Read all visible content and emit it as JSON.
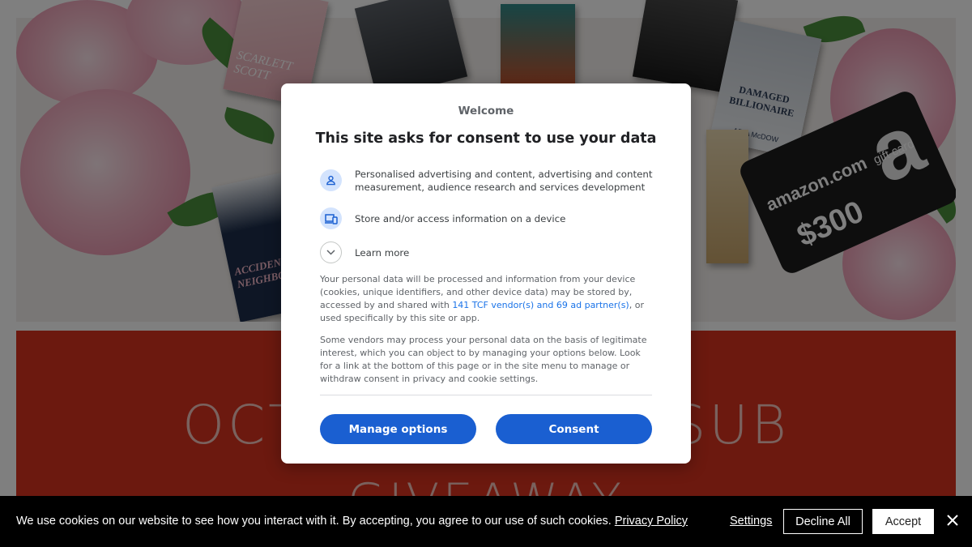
{
  "background": {
    "banner_line1": "OCTOBER BOOK SUB",
    "banner_line2": "GIVEAWAY",
    "gift_card": {
      "brand": "amazon.com",
      "subtitle": "gift card",
      "amount": "$300",
      "logo_letter": "a"
    },
    "books": [
      {
        "title": "SCARLETT SCOTT",
        "color": "#f1c4c8",
        "text_color": "#ffffff"
      },
      {
        "title": "DAMAGED BILLIONAIRE",
        "color": "#d9dde3",
        "text_color": "#2a3a55"
      },
      {
        "title": "ACCIDENTAL NEIGHBOR",
        "color": "#1c2d4a",
        "text_color": "#f4b8c8"
      },
      {
        "title": "ARIA McDOW",
        "color": "#2b4a72",
        "text_color": "#ffffff"
      }
    ],
    "colors": {
      "banner_red": "#d8321f",
      "peony_pink": "#f0a8bd",
      "leaf_green": "#4a8f3c"
    }
  },
  "consent": {
    "welcome": "Welcome",
    "title": "This site asks for consent to use your data",
    "purposes": [
      {
        "icon": "person-icon",
        "text": "Personalised advertising and content, advertising and content measurement, audience research and services development"
      },
      {
        "icon": "devices-icon",
        "text": "Store and/or access information on a device"
      }
    ],
    "learn_more": "Learn more",
    "paragraph1_before": "Your personal data will be processed and information from your device (cookies, unique identifiers, and other device data) may be stored by, accessed by and shared with ",
    "paragraph1_link": "141 TCF vendor(s) and 69 ad partner(s)",
    "paragraph1_after": ", or used specifically by this site or app.",
    "paragraph2": "Some vendors may process your personal data on the basis of legitimate interest, which you can object to by managing your options below. Look for a link at the bottom of this page or in the site menu to manage or withdraw consent in privacy and cookie settings.",
    "manage_button": "Manage options",
    "consent_button": "Consent",
    "accent_color": "#1a5fd1"
  },
  "cookie_bar": {
    "message": "We use cookies on our website to see how you interact with it. By accepting, you agree to our use of such cookies.",
    "privacy_link": "Privacy Policy",
    "settings": "Settings",
    "decline": "Decline All",
    "accept": "Accept",
    "close_icon": "close-icon"
  }
}
